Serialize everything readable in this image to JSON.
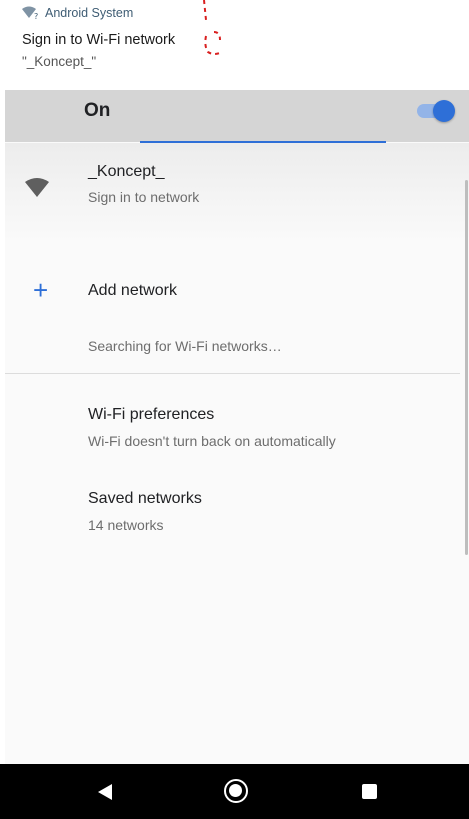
{
  "notification": {
    "app_name": "Android System",
    "title": "Sign in to Wi-Fi network",
    "text": "\"_Koncept_\""
  },
  "wifi_toggle": {
    "label": "On",
    "state": "on",
    "accent_color": "#2e6fd7"
  },
  "connected_network": {
    "icon": "wifi-signal-icon",
    "name": "_Koncept_",
    "status": "Sign in to network"
  },
  "add_network": {
    "icon": "plus-icon",
    "label": "Add network"
  },
  "scan_status": "Searching for Wi-Fi networks…",
  "preferences": {
    "title": "Wi-Fi preferences",
    "subtitle": "Wi-Fi doesn't turn back on automatically"
  },
  "saved_networks": {
    "title": "Saved networks",
    "subtitle": "14 networks"
  },
  "nav_bar": {
    "back_icon": "back-triangle-icon",
    "home_icon": "home-circle-icon",
    "recents_icon": "recents-square-icon"
  }
}
